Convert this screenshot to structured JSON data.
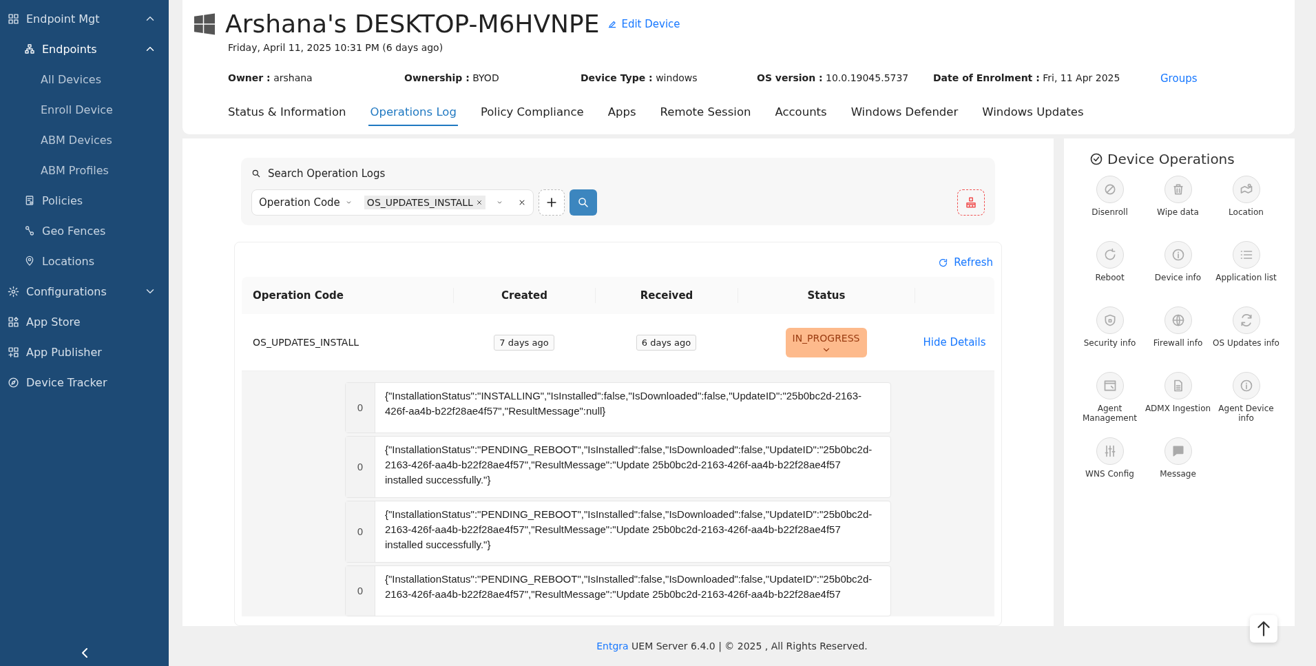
{
  "sidebar": {
    "items": [
      {
        "label": "Endpoint Mgt",
        "expanded": true,
        "children": [
          {
            "label": "Endpoints",
            "expanded": true,
            "children": [
              {
                "label": "All Devices"
              },
              {
                "label": "Enroll Device"
              },
              {
                "label": "ABM Devices"
              },
              {
                "label": "ABM Profiles"
              }
            ]
          },
          {
            "label": "Policies"
          },
          {
            "label": "Geo Fences"
          },
          {
            "label": "Locations"
          }
        ]
      },
      {
        "label": "Configurations",
        "expanded": false
      },
      {
        "label": "App Store"
      },
      {
        "label": "App Publisher"
      },
      {
        "label": "Device Tracker"
      }
    ]
  },
  "device": {
    "title": "Arshana's DESKTOP-M6HVNPE",
    "edit_label": "Edit Device",
    "last_seen": "Friday, April 11, 2025 10:31 PM (6 days ago)",
    "fields": [
      {
        "label": "Owner :",
        "value": "arshana"
      },
      {
        "label": "Ownership :",
        "value": "BYOD"
      },
      {
        "label": "Device Type :",
        "value": "windows"
      },
      {
        "label": "OS version :",
        "value": "10.0.19045.5737"
      },
      {
        "label": "Date of Enrolment :",
        "value": "Fri, 11 Apr 2025"
      }
    ],
    "groups_link": "Groups"
  },
  "tabs": [
    {
      "label": "Status & Information",
      "selected": false
    },
    {
      "label": "Operations Log",
      "selected": true
    },
    {
      "label": "Policy Compliance",
      "selected": false
    },
    {
      "label": "Apps",
      "selected": false
    },
    {
      "label": "Remote Session",
      "selected": false
    },
    {
      "label": "Accounts",
      "selected": false
    },
    {
      "label": "Windows Defender",
      "selected": false
    },
    {
      "label": "Windows Updates",
      "selected": false
    }
  ],
  "search": {
    "title": "Search Operation Logs",
    "filter_field": "Operation Code",
    "filter_tag": "OS_UPDATES_INSTALL"
  },
  "table": {
    "refresh": "Refresh",
    "columns": [
      "Operation Code",
      "Created",
      "Received",
      "Status"
    ],
    "rows": [
      {
        "operation_code": "OS_UPDATES_INSTALL",
        "created": "7 days ago",
        "received": "6 days ago",
        "status": "IN_PROGRESS",
        "action": "Hide Details",
        "expanded": true,
        "details": [
          {
            "index": "0",
            "text": "{\"InstallationStatus\":\"INSTALLING\",\"IsInstalled\":false,\"IsDownloaded\":false,\"UpdateID\":\"25b0bc2d-2163-426f-aa4b-b22f28ae4f57\",\"ResultMessage\":null}"
          },
          {
            "index": "0",
            "text": "{\"InstallationStatus\":\"PENDING_REBOOT\",\"IsInstalled\":false,\"IsDownloaded\":false,\"UpdateID\":\"25b0bc2d-2163-426f-aa4b-b22f28ae4f57\",\"ResultMessage\":\"Update 25b0bc2d-2163-426f-aa4b-b22f28ae4f57 installed successfully.\"}"
          },
          {
            "index": "0",
            "text": "{\"InstallationStatus\":\"PENDING_REBOOT\",\"IsInstalled\":false,\"IsDownloaded\":false,\"UpdateID\":\"25b0bc2d-2163-426f-aa4b-b22f28ae4f57\",\"ResultMessage\":\"Update 25b0bc2d-2163-426f-aa4b-b22f28ae4f57 installed successfully.\"}"
          },
          {
            "index": "0",
            "text": "{\"InstallationStatus\":\"PENDING_REBOOT\",\"IsInstalled\":false,\"IsDownloaded\":false,\"UpdateID\":\"25b0bc2d-2163-426f-aa4b-b22f28ae4f57\",\"ResultMessage\":\"Update 25b0bc2d-2163-426f-aa4b-b22f28ae4f57"
          }
        ]
      }
    ]
  },
  "device_operations": {
    "title": "Device Operations",
    "items": [
      {
        "label": "Disenroll"
      },
      {
        "label": "Wipe data"
      },
      {
        "label": "Location"
      },
      {
        "label": "Reboot"
      },
      {
        "label": "Device info"
      },
      {
        "label": "Application list"
      },
      {
        "label": "Security info"
      },
      {
        "label": "Firewall info"
      },
      {
        "label": "OS Updates info"
      },
      {
        "label": "Agent Management"
      },
      {
        "label": "ADMX Ingestion"
      },
      {
        "label": "Agent Device info"
      },
      {
        "label": "WNS Config"
      },
      {
        "label": "Message"
      }
    ]
  },
  "footer": {
    "link": "Entgra",
    "text": "UEM Server 6.4.0 | © 2025 , All Rights Reserved."
  }
}
